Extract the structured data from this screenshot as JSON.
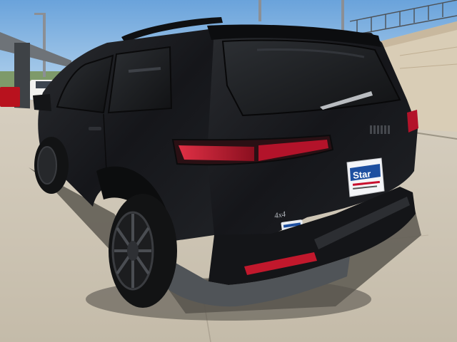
{
  "vehicle": {
    "rear_badge": "4x4",
    "plate": {
      "brand": "Star"
    },
    "colors": {
      "body": "#1b1c1e",
      "glass": "#232528",
      "taillight": "#b3132a",
      "pavement": "#cbc3b5",
      "sky": "#8fbde6",
      "shadow": "#595650"
    }
  }
}
